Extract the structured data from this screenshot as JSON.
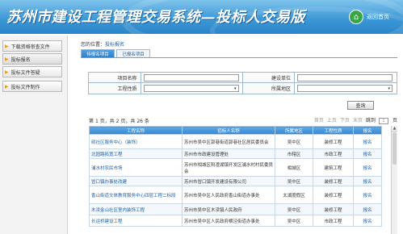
{
  "header": {
    "title": "苏州市建设工程管理交易系统—投标人交易版",
    "home_label": "返回首页"
  },
  "sidebar": {
    "items": [
      {
        "label": "下载资格审查文件"
      },
      {
        "label": "投标报名"
      },
      {
        "label": "投标文件答疑"
      },
      {
        "label": "投标文件制作"
      }
    ]
  },
  "location": {
    "prefix": "您的位置：",
    "current": "投标报名"
  },
  "tabs": [
    {
      "label": "待报名项目"
    },
    {
      "label": "已报名项目"
    }
  ],
  "search": {
    "project_label": "项目名称",
    "build_unit_label": "建设单位",
    "type_label": "工程性质",
    "area_label": "所属地区",
    "query_label": "查询"
  },
  "pager": {
    "info_prefix": "第",
    "current_page": "1",
    "info_mid1": "页，共",
    "total_pages": "2",
    "info_mid2": "页，共",
    "total_items": "26",
    "info_suffix": "条",
    "first": "首页",
    "prev": "上页",
    "next": "下页",
    "last": "末页",
    "jump_label": "跳到",
    "jump_value": "1",
    "page_label": "页"
  },
  "table": {
    "headers": [
      "工程名称",
      "招标人名称",
      "所属地区",
      "工程性质",
      "报名"
    ],
    "rows": [
      [
        "硕社区服务中心（装饰）",
        "苏州市吴中区郭巷街道郭巷社区居民委员会",
        "吴中区",
        "装修工程",
        "报名"
      ],
      [
        "北园路拓宽工程",
        "苏州市市政建设管理处",
        "市辖区",
        "市政工程",
        "报名"
      ],
      [
        "浦水村农民市场",
        "苏州市相城区阳澄湖镇开发区浦水村村民委员会",
        "相城区",
        "建筑工程",
        "报名"
      ],
      [
        "冒口镇办事处改建",
        "苏州市冒口镇开发建设有限公司",
        "吴中区",
        "装修工程",
        "报名"
      ],
      [
        "香山街道文体教育服务中心四层工程二标段",
        "苏州市吴中区人民政府香山街道办事处",
        "太湖度假区",
        "装修工程",
        "报名"
      ],
      [
        "木渎金山社区室内装饰工程",
        "苏州市吴中区木渎镇人民政府",
        "吴中区",
        "装修工程",
        "报名"
      ],
      [
        "长运桥建设工程",
        "苏州市吴中区人民政府横泾街道办事处",
        "吴中区",
        "市政工程",
        "报名"
      ]
    ]
  },
  "colors": {
    "header_blue": "#3e98d6",
    "tab_active": "#2c7fc8",
    "link": "#1e5fa8",
    "home_green": "#3aa546"
  },
  "icons": {
    "home": "home-icon",
    "sidebar_bullet": "triangle-right-icon"
  }
}
